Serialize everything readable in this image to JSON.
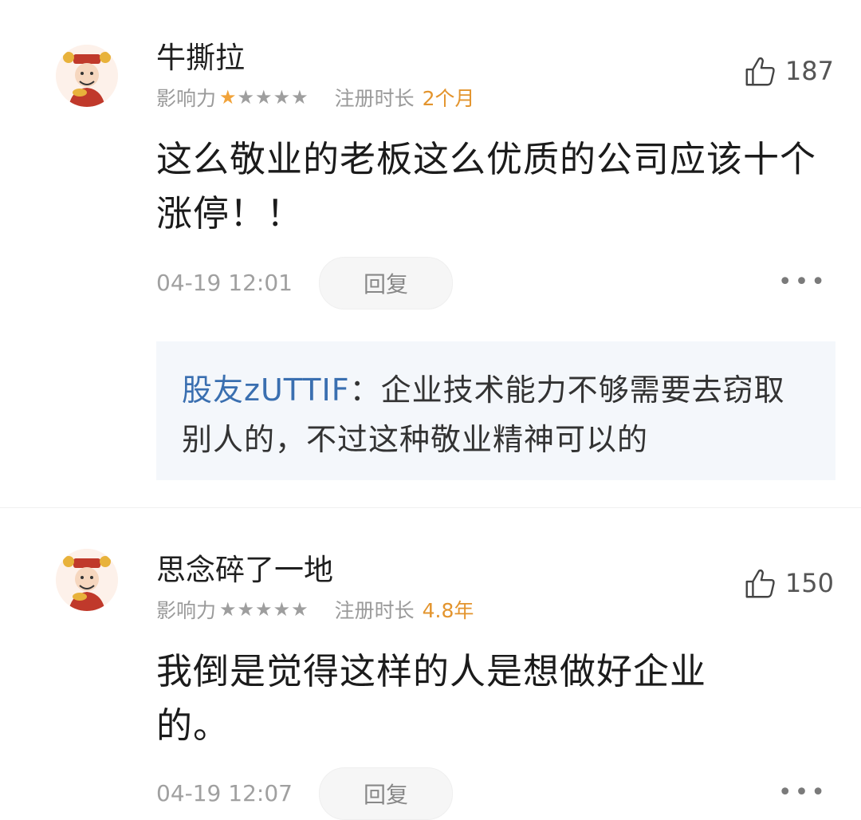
{
  "comments": [
    {
      "username": "牛撕拉",
      "influence_label": "影响力",
      "rating": 1,
      "rating_max": 5,
      "register_label": "注册时长",
      "register_value": "2个月",
      "like_count": "187",
      "content": "这么敬业的老板这么优质的公司应该十个涨停！！",
      "time": "04-19 12:01",
      "reply_label": "回复",
      "more_label": "•••",
      "sub_reply": {
        "user": "股友zUTTIF",
        "separator": "：",
        "text": "企业技术能力不够需要去窃取别人的，不过这种敬业精神可以的"
      }
    },
    {
      "username": "思念碎了一地",
      "influence_label": "影响力",
      "rating": 0,
      "rating_max": 5,
      "register_label": "注册时长",
      "register_value": "4.8年",
      "like_count": "150",
      "content": "我倒是觉得这样的人是想做好企业的。",
      "time": "04-19 12:07",
      "reply_label": "回复",
      "more_label": "•••"
    }
  ],
  "colors": {
    "accent_orange": "#e3942d",
    "star_active": "#f1a33a",
    "link_blue": "#3a6fb0"
  },
  "icons": {
    "like": "thumbs-up-icon",
    "more": "more-dots-icon",
    "avatar": "caishen-avatar-icon"
  }
}
